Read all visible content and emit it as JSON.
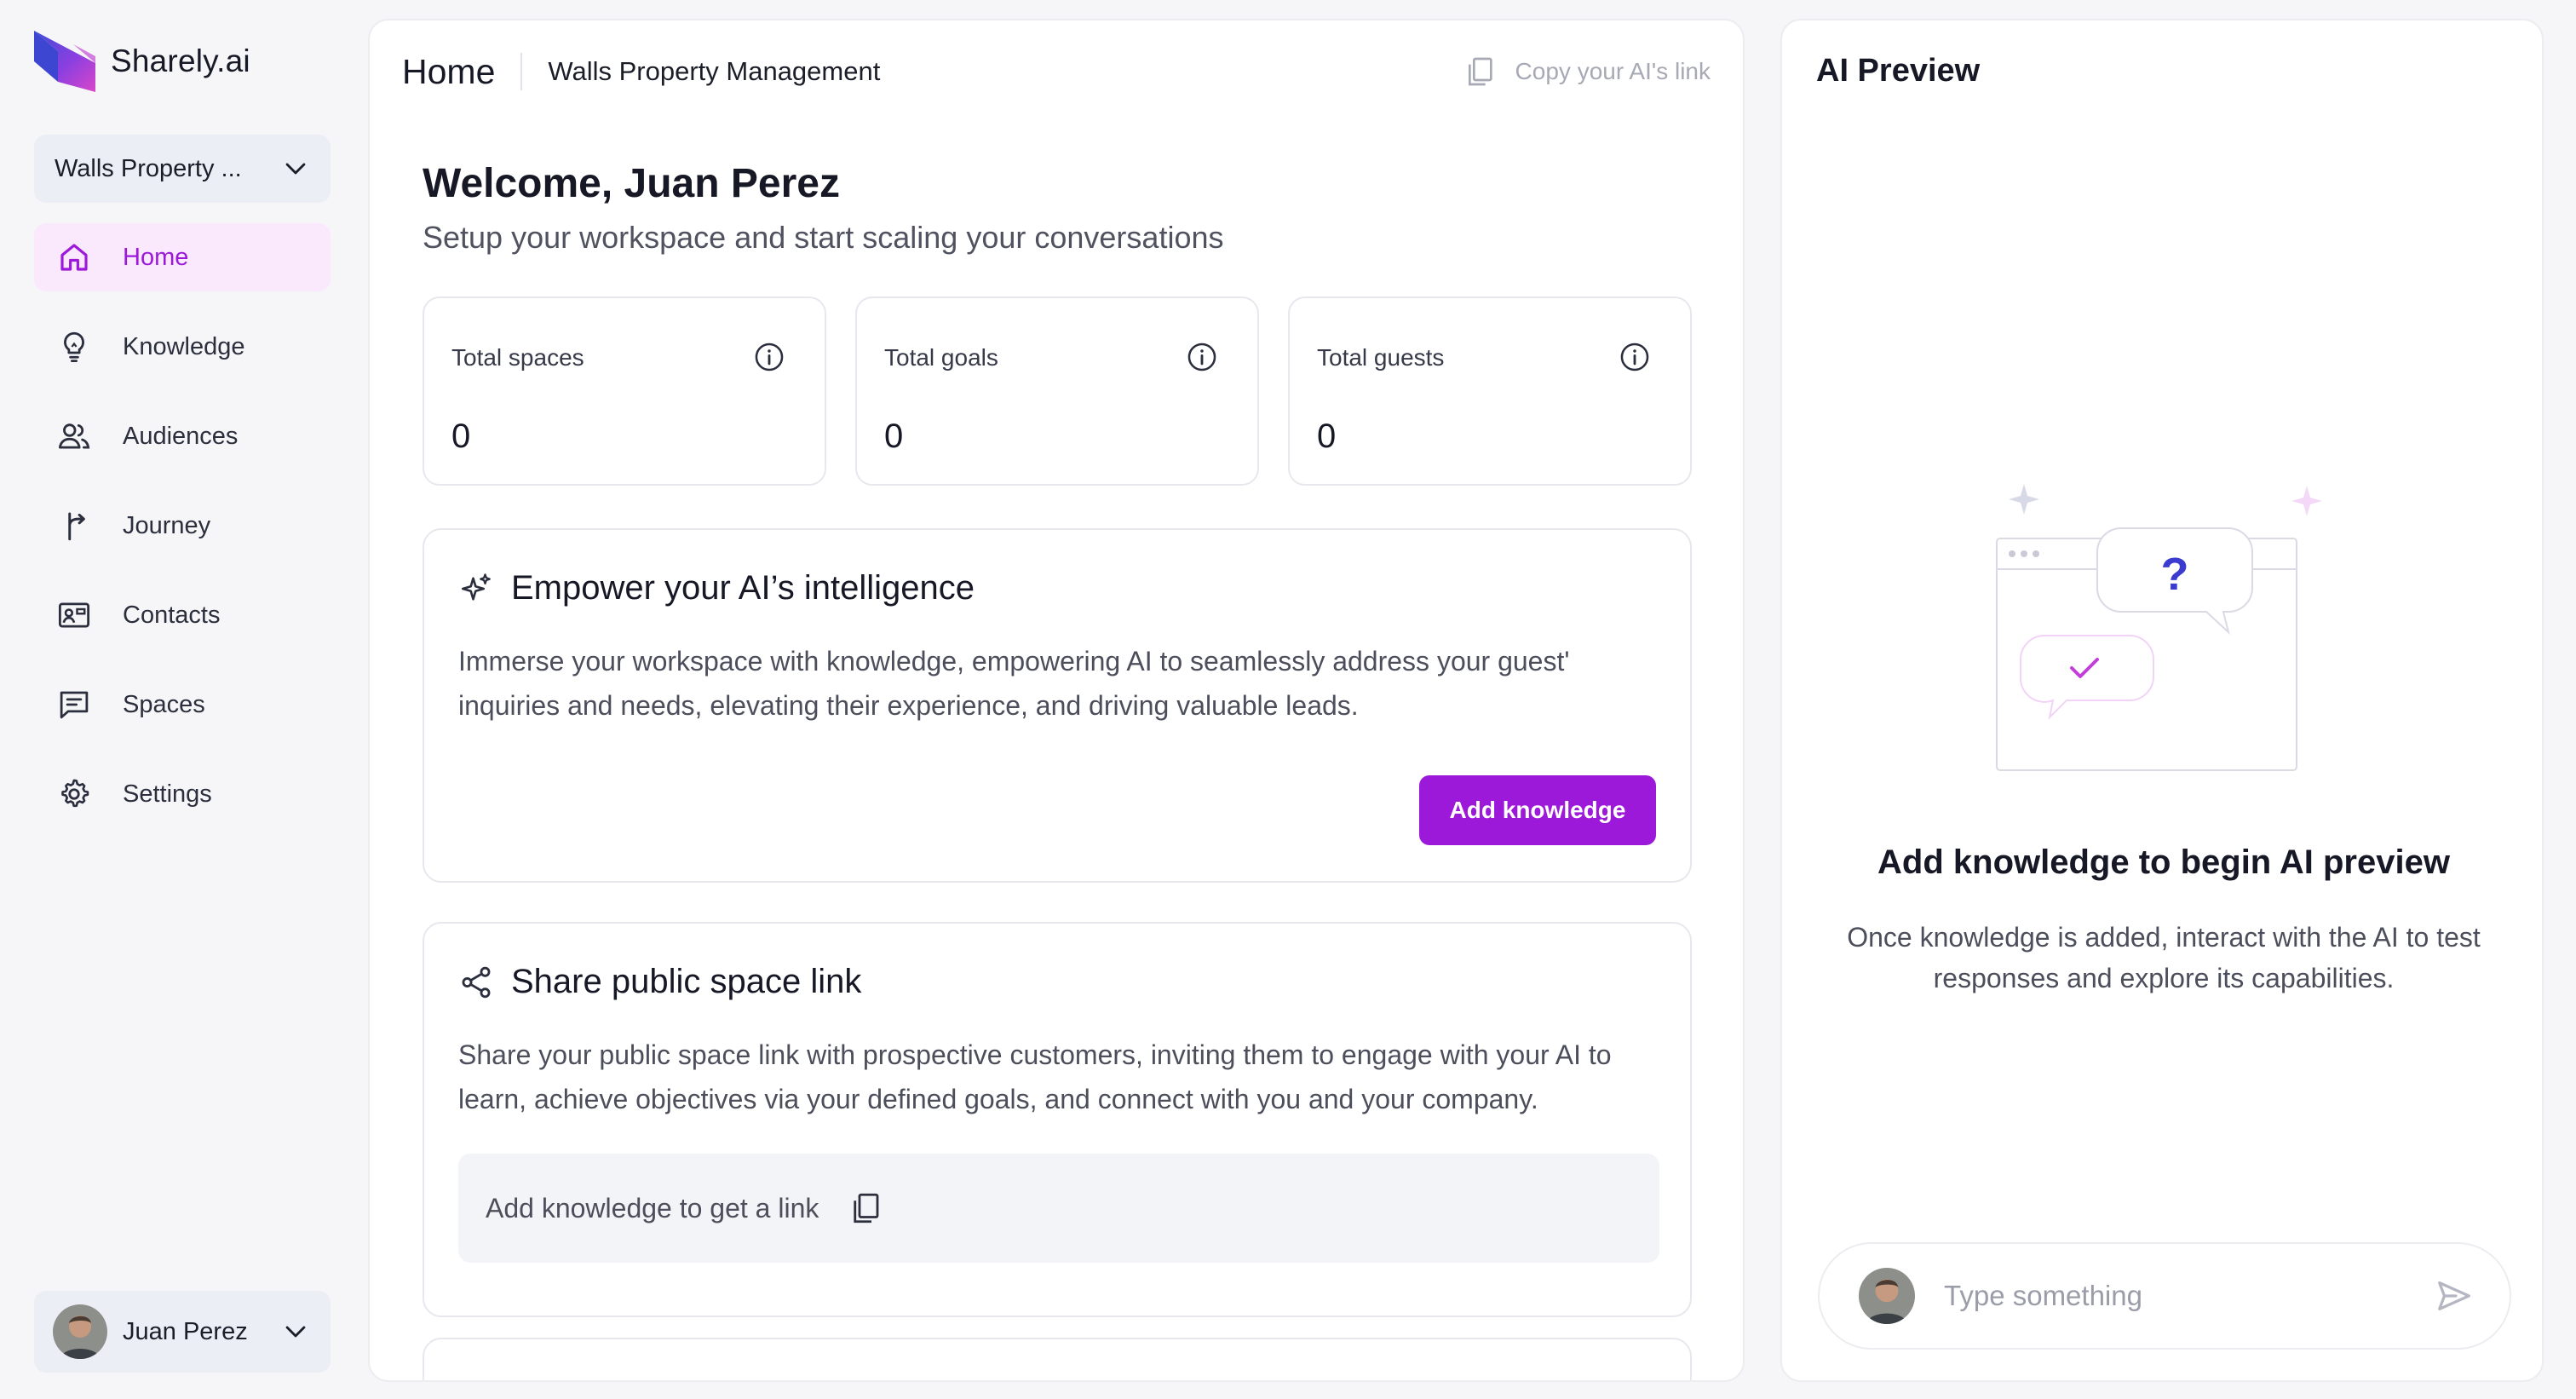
{
  "app": {
    "name": "Sharely.ai"
  },
  "sidebar": {
    "workspace": "Walls Property ...",
    "items": [
      {
        "label": "Home",
        "icon": "home-icon",
        "active": true
      },
      {
        "label": "Knowledge",
        "icon": "lightbulb-icon"
      },
      {
        "label": "Audiences",
        "icon": "users-icon"
      },
      {
        "label": "Journey",
        "icon": "journey-icon"
      },
      {
        "label": "Contacts",
        "icon": "contact-card-icon"
      },
      {
        "label": "Spaces",
        "icon": "chat-icon"
      },
      {
        "label": "Settings",
        "icon": "gear-icon"
      }
    ],
    "user": "Juan Perez"
  },
  "header": {
    "breadcrumb_home": "Home",
    "workspace_name": "Walls Property Management",
    "copy_link": "Copy your AI's link"
  },
  "main": {
    "welcome": "Welcome, Juan Perez",
    "subtitle": "Setup your workspace and start scaling your conversations",
    "stats": [
      {
        "label": "Total spaces",
        "value": "0"
      },
      {
        "label": "Total goals",
        "value": "0"
      },
      {
        "label": "Total guests",
        "value": "0"
      }
    ],
    "knowledge_card": {
      "title": "Empower your AI’s intelligence",
      "description": "Immerse your workspace with knowledge, empowering AI to seamlessly address your guest' inquiries and needs, elevating their experience, and driving valuable leads.",
      "button": "Add knowledge"
    },
    "share_card": {
      "title": "Share public space link",
      "description": "Share your public space link with prospective customers, inviting them to engage with your AI to learn, achieve objectives via your defined goals, and connect with you and your company.",
      "link_placeholder": "Add knowledge to get a link"
    }
  },
  "preview": {
    "title": "AI Preview",
    "empty_title": "Add knowledge to begin AI preview",
    "empty_description": "Once knowledge is added, interact with the AI to test responses and explore its capabilities.",
    "input_placeholder": "Type something"
  },
  "colors": {
    "accent": "#9c19d9",
    "active_bg": "#fae8fd"
  }
}
